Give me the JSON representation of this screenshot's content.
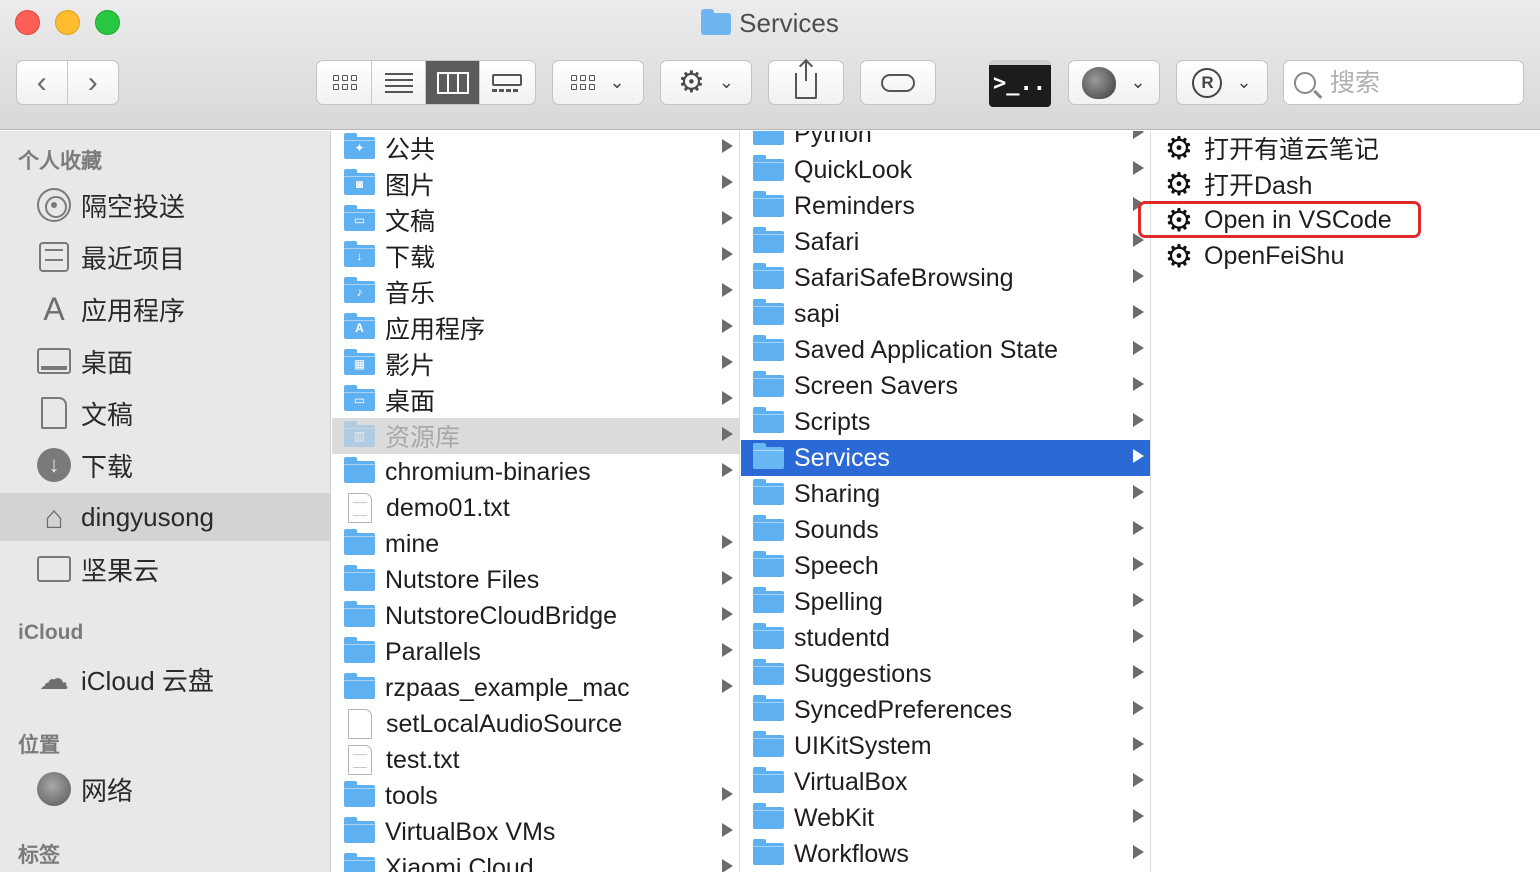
{
  "window": {
    "title": "Services"
  },
  "toolbar": {
    "search_placeholder": "搜索",
    "terminal_label": ">_..",
    "icons": [
      "back-icon",
      "forward-icon",
      "icon-view-icon",
      "list-view-icon",
      "column-view-icon",
      "gallery-view-icon",
      "group-icon",
      "gear-icon",
      "share-icon",
      "tag-icon",
      "terminal-icon",
      "acorn-icon",
      "r-icon",
      "search-icon"
    ]
  },
  "sidebar": {
    "favorites_title": "个人收藏",
    "favorites": [
      {
        "label": "隔空投送",
        "icon": "airdrop-icon"
      },
      {
        "label": "最近项目",
        "icon": "recents-icon"
      },
      {
        "label": "应用程序",
        "icon": "applications-icon"
      },
      {
        "label": "桌面",
        "icon": "desktop-icon"
      },
      {
        "label": "文稿",
        "icon": "document-icon"
      },
      {
        "label": "下载",
        "icon": "download-icon"
      },
      {
        "label": "dingyusong",
        "icon": "home-icon",
        "selected": true
      },
      {
        "label": "坚果云",
        "icon": "folder-icon"
      }
    ],
    "icloud_title": "iCloud",
    "icloud": [
      {
        "label": "iCloud 云盘",
        "icon": "cloud-icon"
      }
    ],
    "locations_title": "位置",
    "locations": [
      {
        "label": "网络",
        "icon": "network-icon"
      }
    ],
    "tags_title": "标签"
  },
  "column1": {
    "items": [
      {
        "label": "公共",
        "type": "folder",
        "glyph": "✦"
      },
      {
        "label": "图片",
        "type": "folder",
        "glyph": "◙"
      },
      {
        "label": "文稿",
        "type": "folder",
        "glyph": "▭"
      },
      {
        "label": "下载",
        "type": "folder",
        "glyph": "↓"
      },
      {
        "label": "音乐",
        "type": "folder",
        "glyph": "♪"
      },
      {
        "label": "应用程序",
        "type": "folder",
        "glyph": "A"
      },
      {
        "label": "影片",
        "type": "folder",
        "glyph": "▦"
      },
      {
        "label": "桌面",
        "type": "folder",
        "glyph": "▭"
      },
      {
        "label": "资源库",
        "type": "folder",
        "glyph": "▥",
        "state": "dim"
      },
      {
        "label": "chromium-binaries",
        "type": "folder"
      },
      {
        "label": "demo01.txt",
        "type": "file"
      },
      {
        "label": "mine",
        "type": "folder"
      },
      {
        "label": "Nutstore Files",
        "type": "folder"
      },
      {
        "label": "NutstoreCloudBridge",
        "type": "folder"
      },
      {
        "label": "Parallels",
        "type": "folder"
      },
      {
        "label": "rzpaas_example_mac",
        "type": "folder"
      },
      {
        "label": "setLocalAudioSource",
        "type": "file"
      },
      {
        "label": "test.txt",
        "type": "file"
      },
      {
        "label": "tools",
        "type": "folder"
      },
      {
        "label": "VirtualBox VMs",
        "type": "folder"
      },
      {
        "label": "Xiaomi Cloud",
        "type": "folder"
      }
    ]
  },
  "column2": {
    "items": [
      {
        "label": "Python"
      },
      {
        "label": "QuickLook"
      },
      {
        "label": "Reminders"
      },
      {
        "label": "Safari"
      },
      {
        "label": "SafariSafeBrowsing"
      },
      {
        "label": "sapi"
      },
      {
        "label": "Saved Application State"
      },
      {
        "label": "Screen Savers"
      },
      {
        "label": "Scripts"
      },
      {
        "label": "Services",
        "state": "sel"
      },
      {
        "label": "Sharing"
      },
      {
        "label": "Sounds"
      },
      {
        "label": "Speech"
      },
      {
        "label": "Spelling"
      },
      {
        "label": "studentd"
      },
      {
        "label": "Suggestions"
      },
      {
        "label": "SyncedPreferences"
      },
      {
        "label": "UIKitSystem"
      },
      {
        "label": "VirtualBox"
      },
      {
        "label": "WebKit"
      },
      {
        "label": "Workflows"
      }
    ]
  },
  "column3": {
    "items": [
      {
        "label": "打开有道云笔记"
      },
      {
        "label": "打开Dash"
      },
      {
        "label": "Open in VSCode",
        "highlighted": true
      },
      {
        "label": "OpenFeiShu"
      }
    ]
  },
  "colors": {
    "selection": "#2a69d6",
    "highlight_box": "#e02a2a",
    "folder": "#5fb0f0"
  }
}
